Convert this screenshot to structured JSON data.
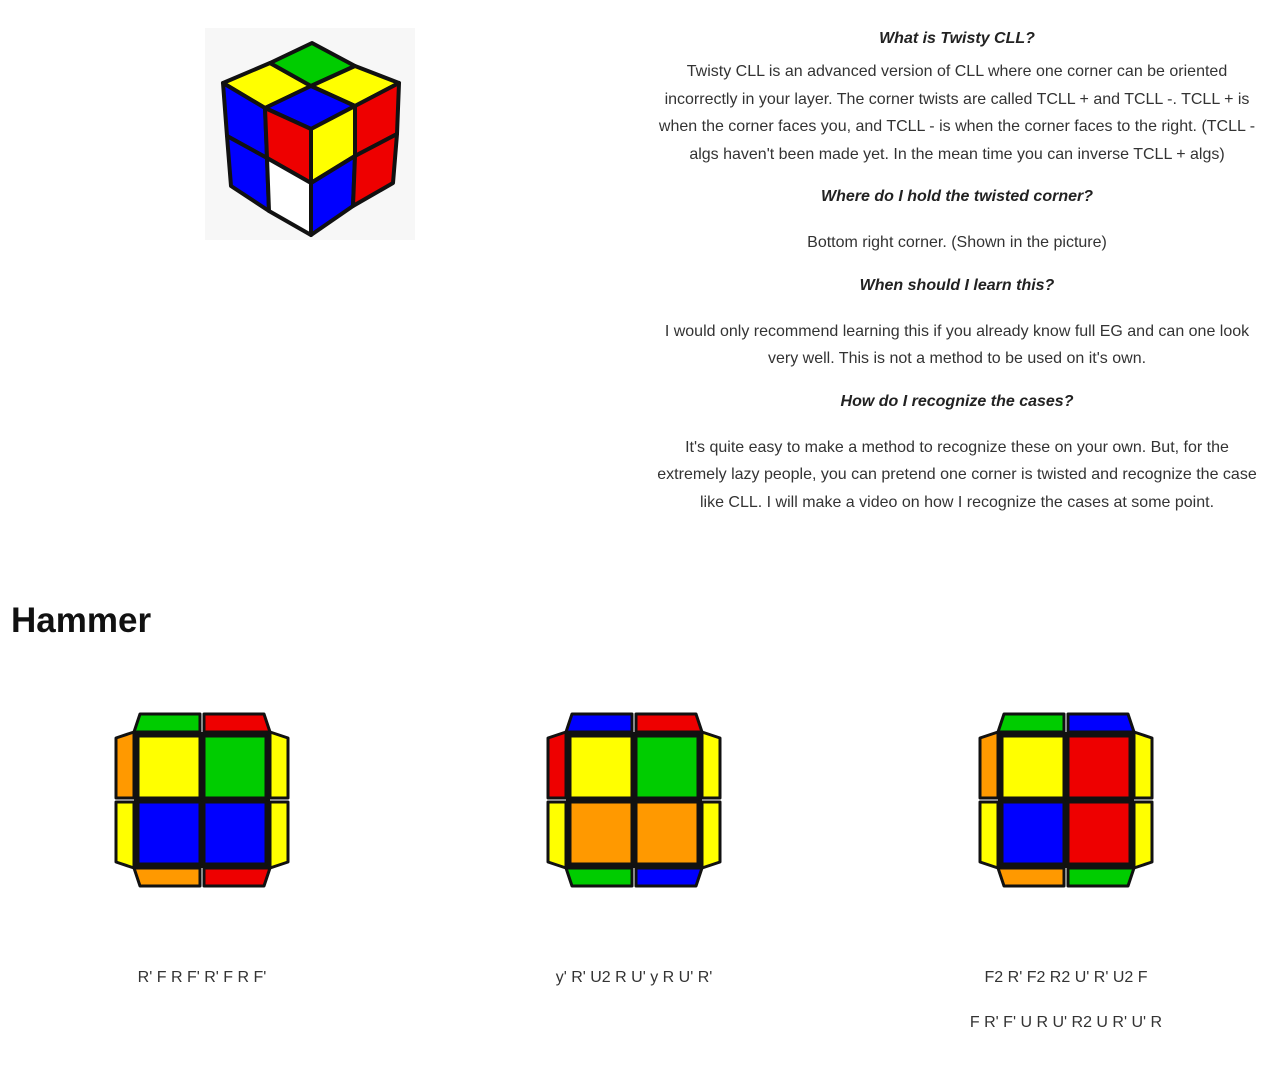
{
  "hero": {
    "image_name": "2x2 cube with twisted corner",
    "colors": {
      "top_left": "#ffff00",
      "top_back": "#00cc00",
      "top_right": "#ffff00",
      "top_front": "#0000ff",
      "left_top": "#0000ff",
      "left_bottom": "#0000ff",
      "left_front_top": "#ee0000",
      "left_front_bottom": "#ffffff",
      "right_front_top": "#ffff00",
      "right_front_bottom": "#0000ff",
      "right_back_top": "#ee0000",
      "right_back_bottom": "#ee0000"
    }
  },
  "faq": [
    {
      "question": "What is Twisty CLL?",
      "answer": "Twisty CLL is an advanced version of CLL where one corner can be oriented incorrectly in your layer. The corner twists are called TCLL + and TCLL -. TCLL + is when the corner faces you, and TCLL - is when the corner faces to the right. (TCLL - algs haven't been made yet. In the mean time you can inverse TCLL + algs)"
    },
    {
      "question": "Where do I hold the twisted corner?",
      "answer": "Bottom right corner. (Shown in the picture)"
    },
    {
      "question": "When should I learn this?",
      "answer": "I would only recommend learning this if you already know full EG and can one look very well. This is not a method to be used on it's own."
    },
    {
      "question": "How do I recognize the cases?",
      "answer": "It's quite easy to make a method to recognize these on your own. But, for the extremely lazy people, you can pretend one corner is twisted and recognize the case like CLL. I will make a video on how I recognize the cases at some point."
    }
  ],
  "section_title": "Hammer",
  "cases": [
    {
      "algs": [
        "R' F R F' R' F R F'"
      ],
      "stickers": {
        "top": [
          "#ffff00",
          "#00cc00",
          "#0000ff",
          "#0000ff"
        ],
        "back": [
          "#00cc00",
          "#ee0000"
        ],
        "front": [
          "#ff9900",
          "#ee0000"
        ],
        "left": [
          "#ff9900",
          "#ffff00"
        ],
        "right": [
          "#ffff00",
          "#ffff00"
        ]
      }
    },
    {
      "algs": [
        "y' R' U2 R U' y R U' R'"
      ],
      "stickers": {
        "top": [
          "#ffff00",
          "#00cc00",
          "#ff9900",
          "#ff9900"
        ],
        "back": [
          "#0000ff",
          "#ee0000"
        ],
        "front": [
          "#00cc00",
          "#0000ff"
        ],
        "left": [
          "#ee0000",
          "#ffff00"
        ],
        "right": [
          "#ffff00",
          "#ffff00"
        ]
      }
    },
    {
      "algs": [
        "F2 R' F2 R2 U' R' U2 F",
        "F R' F' U R U' R2 U R' U' R"
      ],
      "stickers": {
        "top": [
          "#ffff00",
          "#ee0000",
          "#0000ff",
          "#ee0000"
        ],
        "back": [
          "#00cc00",
          "#0000ff"
        ],
        "front": [
          "#ff9900",
          "#00cc00"
        ],
        "left": [
          "#ff9900",
          "#ffff00"
        ],
        "right": [
          "#ffff00",
          "#ffff00"
        ]
      }
    }
  ]
}
